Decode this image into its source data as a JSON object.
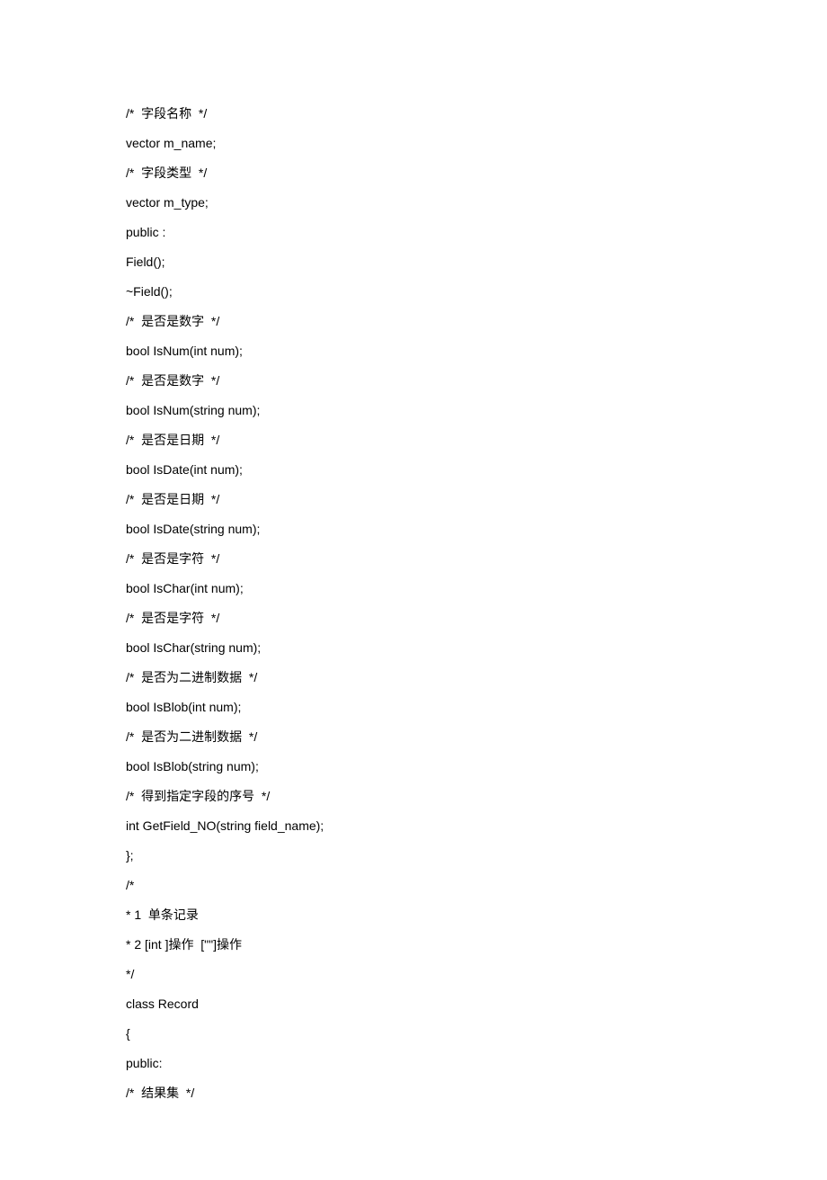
{
  "lines": [
    "/*  字段名称  */",
    "vector m_name;",
    "/*  字段类型  */",
    "vector m_type;",
    "public :",
    "Field();",
    "~Field();",
    "/*  是否是数字  */",
    "bool IsNum(int num);",
    "/*  是否是数字  */",
    "bool IsNum(string num);",
    "/*  是否是日期  */",
    "bool IsDate(int num);",
    "/*  是否是日期  */",
    "bool IsDate(string num);",
    "/*  是否是字符  */",
    "bool IsChar(int num);",
    "/*  是否是字符  */",
    "bool IsChar(string num);",
    "/*  是否为二进制数据  */",
    "bool IsBlob(int num);",
    "/*  是否为二进制数据  */",
    "bool IsBlob(string num);",
    "/*  得到指定字段的序号  */",
    "int GetField_NO(string field_name);",
    "};",
    "/*",
    "* 1  单条记录",
    "* 2 [int ]操作  [\"\"]操作",
    "*/",
    "class Record",
    "{",
    "public:",
    "/*  结果集  */"
  ]
}
